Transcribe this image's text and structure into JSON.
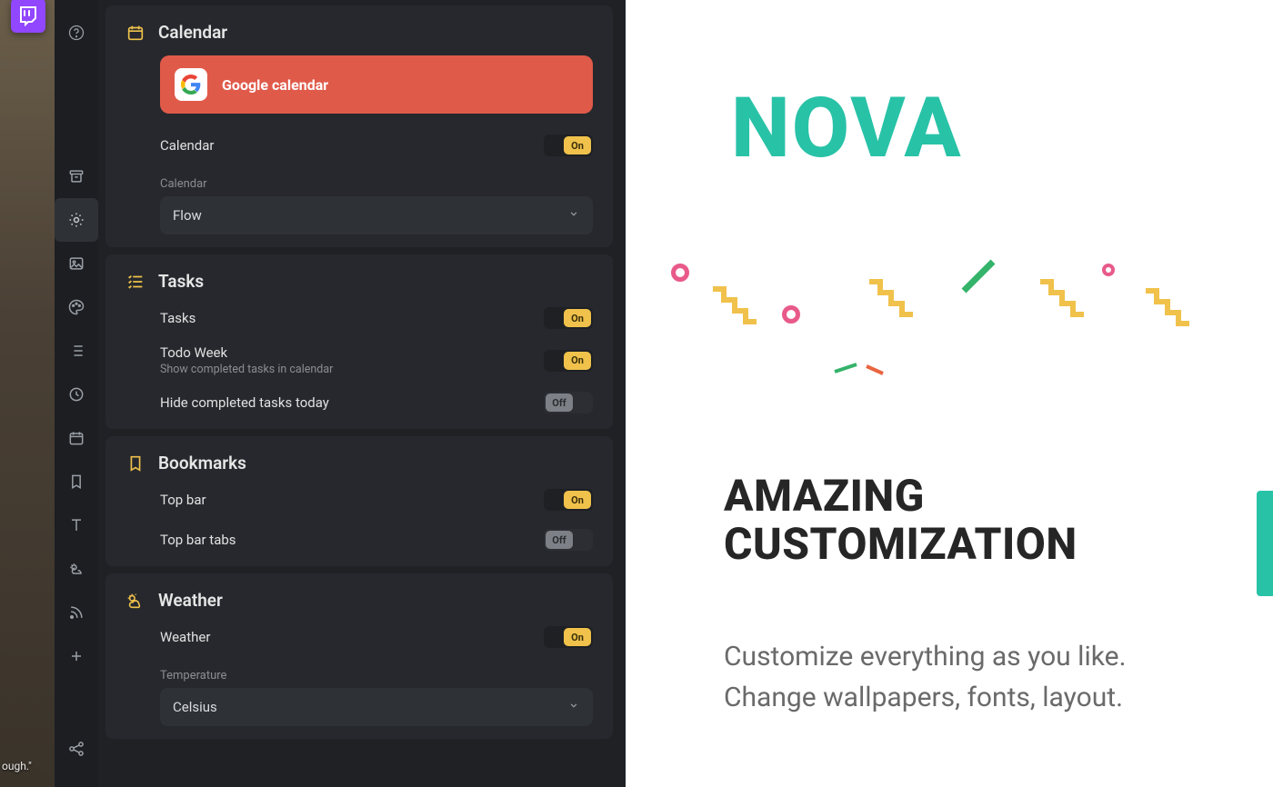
{
  "bg": {
    "caption": "ough.\""
  },
  "nav": {
    "items": [
      {
        "id": "help",
        "icon": "help"
      },
      {
        "id": "archive",
        "icon": "archive"
      },
      {
        "id": "settings",
        "icon": "gear",
        "active": true
      },
      {
        "id": "image",
        "icon": "image"
      },
      {
        "id": "palette",
        "icon": "palette"
      },
      {
        "id": "list",
        "icon": "list"
      },
      {
        "id": "clock",
        "icon": "clock"
      },
      {
        "id": "calendar",
        "icon": "calendar"
      },
      {
        "id": "bookmark",
        "icon": "bookmark"
      },
      {
        "id": "text",
        "icon": "text"
      },
      {
        "id": "weather",
        "icon": "weather"
      },
      {
        "id": "rss",
        "icon": "rss"
      },
      {
        "id": "add",
        "icon": "plus"
      },
      {
        "id": "share",
        "icon": "share"
      }
    ]
  },
  "sections": {
    "calendar": {
      "title": "Calendar",
      "connect_label": "Google calendar",
      "rows": {
        "enable": {
          "label": "Calendar",
          "state": "On"
        },
        "style_label": "Calendar",
        "style_value": "Flow"
      }
    },
    "tasks": {
      "title": "Tasks",
      "rows": {
        "enable": {
          "label": "Tasks",
          "state": "On"
        },
        "todo_week": {
          "label": "Todo Week",
          "sub": "Show completed tasks in calendar",
          "state": "On"
        },
        "hide_completed": {
          "label": "Hide completed tasks today",
          "state": "Off"
        }
      }
    },
    "bookmarks": {
      "title": "Bookmarks",
      "rows": {
        "top_bar": {
          "label": "Top bar",
          "state": "On"
        },
        "top_bar_tabs": {
          "label": "Top bar tabs",
          "state": "Off"
        }
      }
    },
    "weather": {
      "title": "Weather",
      "rows": {
        "enable": {
          "label": "Weather",
          "state": "On"
        },
        "temp_label": "Temperature",
        "temp_value": "Celsius"
      }
    }
  },
  "toggle_labels": {
    "on": "On",
    "off": "Off"
  },
  "promo": {
    "brand": "NOVA",
    "headline_1": "AMAZING",
    "headline_2": "CUSTOMIZATION",
    "body": "Customize everything as you like. Change wallpapers, fonts, layout."
  },
  "colors": {
    "accent": "#f0c24b",
    "connect_btn": "#e05a4a",
    "brand": "#28c2a7"
  }
}
